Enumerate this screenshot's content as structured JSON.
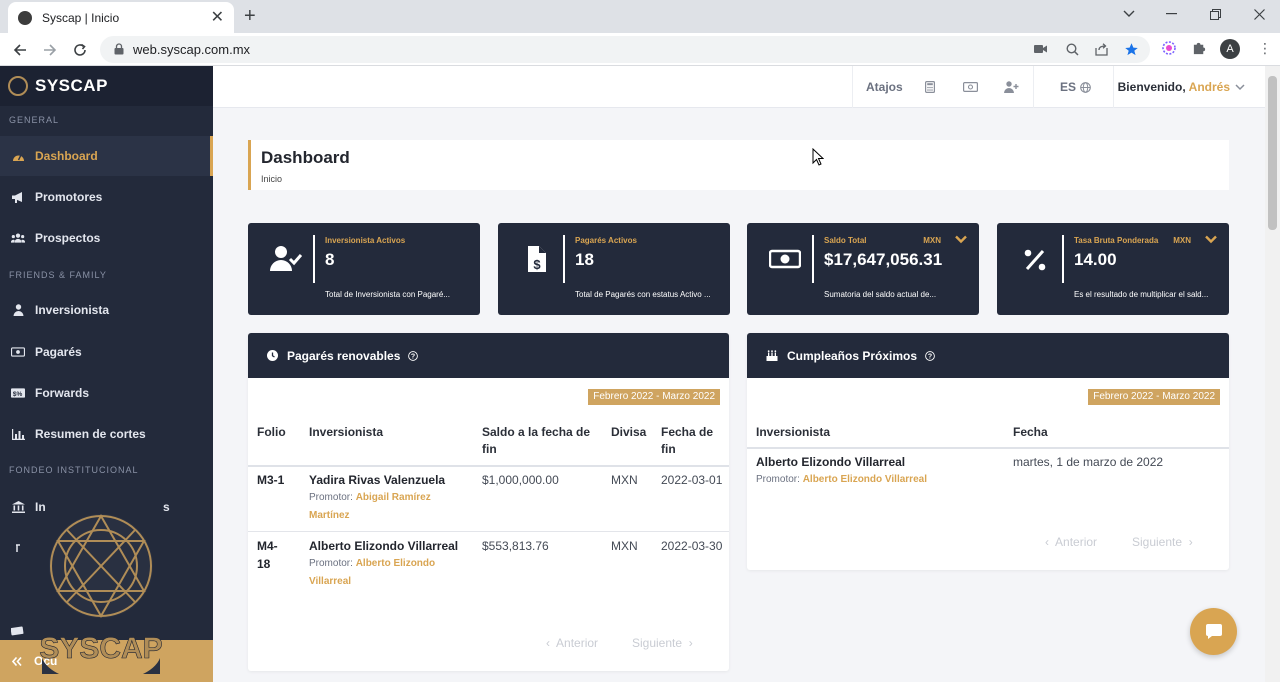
{
  "browser": {
    "tab_title": "Syscap | Inicio",
    "url": "web.syscap.com.mx"
  },
  "sidebar": {
    "brand": "SYSCAP",
    "sections": {
      "general": "GENERAL",
      "friends": "FRIENDS & FAMILY",
      "fondeo": "FONDEO INSTITUCIONAL"
    },
    "items": {
      "dashboard": "Dashboard",
      "promotores": "Promotores",
      "prospectos": "Prospectos",
      "inversionista": "Inversionista",
      "pagares": "Pagarés",
      "forwards": "Forwards",
      "resumen": "Resumen de cortes",
      "inst_partial": "In",
      "inst_partial_end": "s"
    },
    "collapse_label": "Ocu",
    "watermark": "SYSCAP"
  },
  "topbar": {
    "shortcuts": "Atajos",
    "lang": "ES",
    "welcome": "Bienvenido,",
    "user": "Andrés"
  },
  "page": {
    "title": "Dashboard",
    "breadcrumb": "Inicio"
  },
  "stats": [
    {
      "label": "Inversionista Activos",
      "value": "8",
      "desc": "Total de Inversionista con Pagaré...",
      "currency": ""
    },
    {
      "label": "Pagarés Activos",
      "value": "18",
      "desc": "Total de Pagarés con estatus Activo ...",
      "currency": ""
    },
    {
      "label": "Saldo Total",
      "value": "$17,647,056.31",
      "desc": "Sumatoria del saldo actual de...",
      "currency": "MXN"
    },
    {
      "label": "Tasa Bruta Ponderada",
      "value": "14.00",
      "desc": "Es el resultado de multiplicar el sald...",
      "currency": "MXN"
    }
  ],
  "renovables": {
    "title": "Pagarés renovables",
    "range": "Febrero 2022 - Marzo 2022",
    "columns": [
      "Folio",
      "Inversionista",
      "Saldo a la fecha de fin",
      "Divisa",
      "Fecha de fin"
    ],
    "promotor_label": "Promotor:",
    "rows": [
      {
        "folio": "M3-1",
        "inversionista": "Yadira Rivas Valenzuela",
        "promotor": "Abigail Ramírez Martínez",
        "saldo": "$1,000,000.00",
        "divisa": "MXN",
        "fecha": "2022-03-01"
      },
      {
        "folio": "M4-18",
        "inversionista": "Alberto Elizondo Villarreal",
        "promotor": "Alberto Elizondo Villarreal",
        "saldo": "$553,813.76",
        "divisa": "MXN",
        "fecha": "2022-03-30"
      }
    ],
    "prev": "Anterior",
    "next": "Siguiente"
  },
  "cumpleanos": {
    "title": "Cumpleaños Próximos",
    "range": "Febrero 2022 - Marzo 2022",
    "columns": [
      "Inversionista",
      "Fecha"
    ],
    "promotor_label": "Promotor:",
    "rows": [
      {
        "inversionista": "Alberto Elizondo Villarreal",
        "promotor": "Alberto Elizondo Villarreal",
        "fecha": "martes, 1 de marzo de 2022"
      }
    ],
    "prev": "Anterior",
    "next": "Siguiente"
  },
  "colors": {
    "dark": "#232a3b",
    "accent": "#d9a552",
    "badge": "#cfa460"
  }
}
